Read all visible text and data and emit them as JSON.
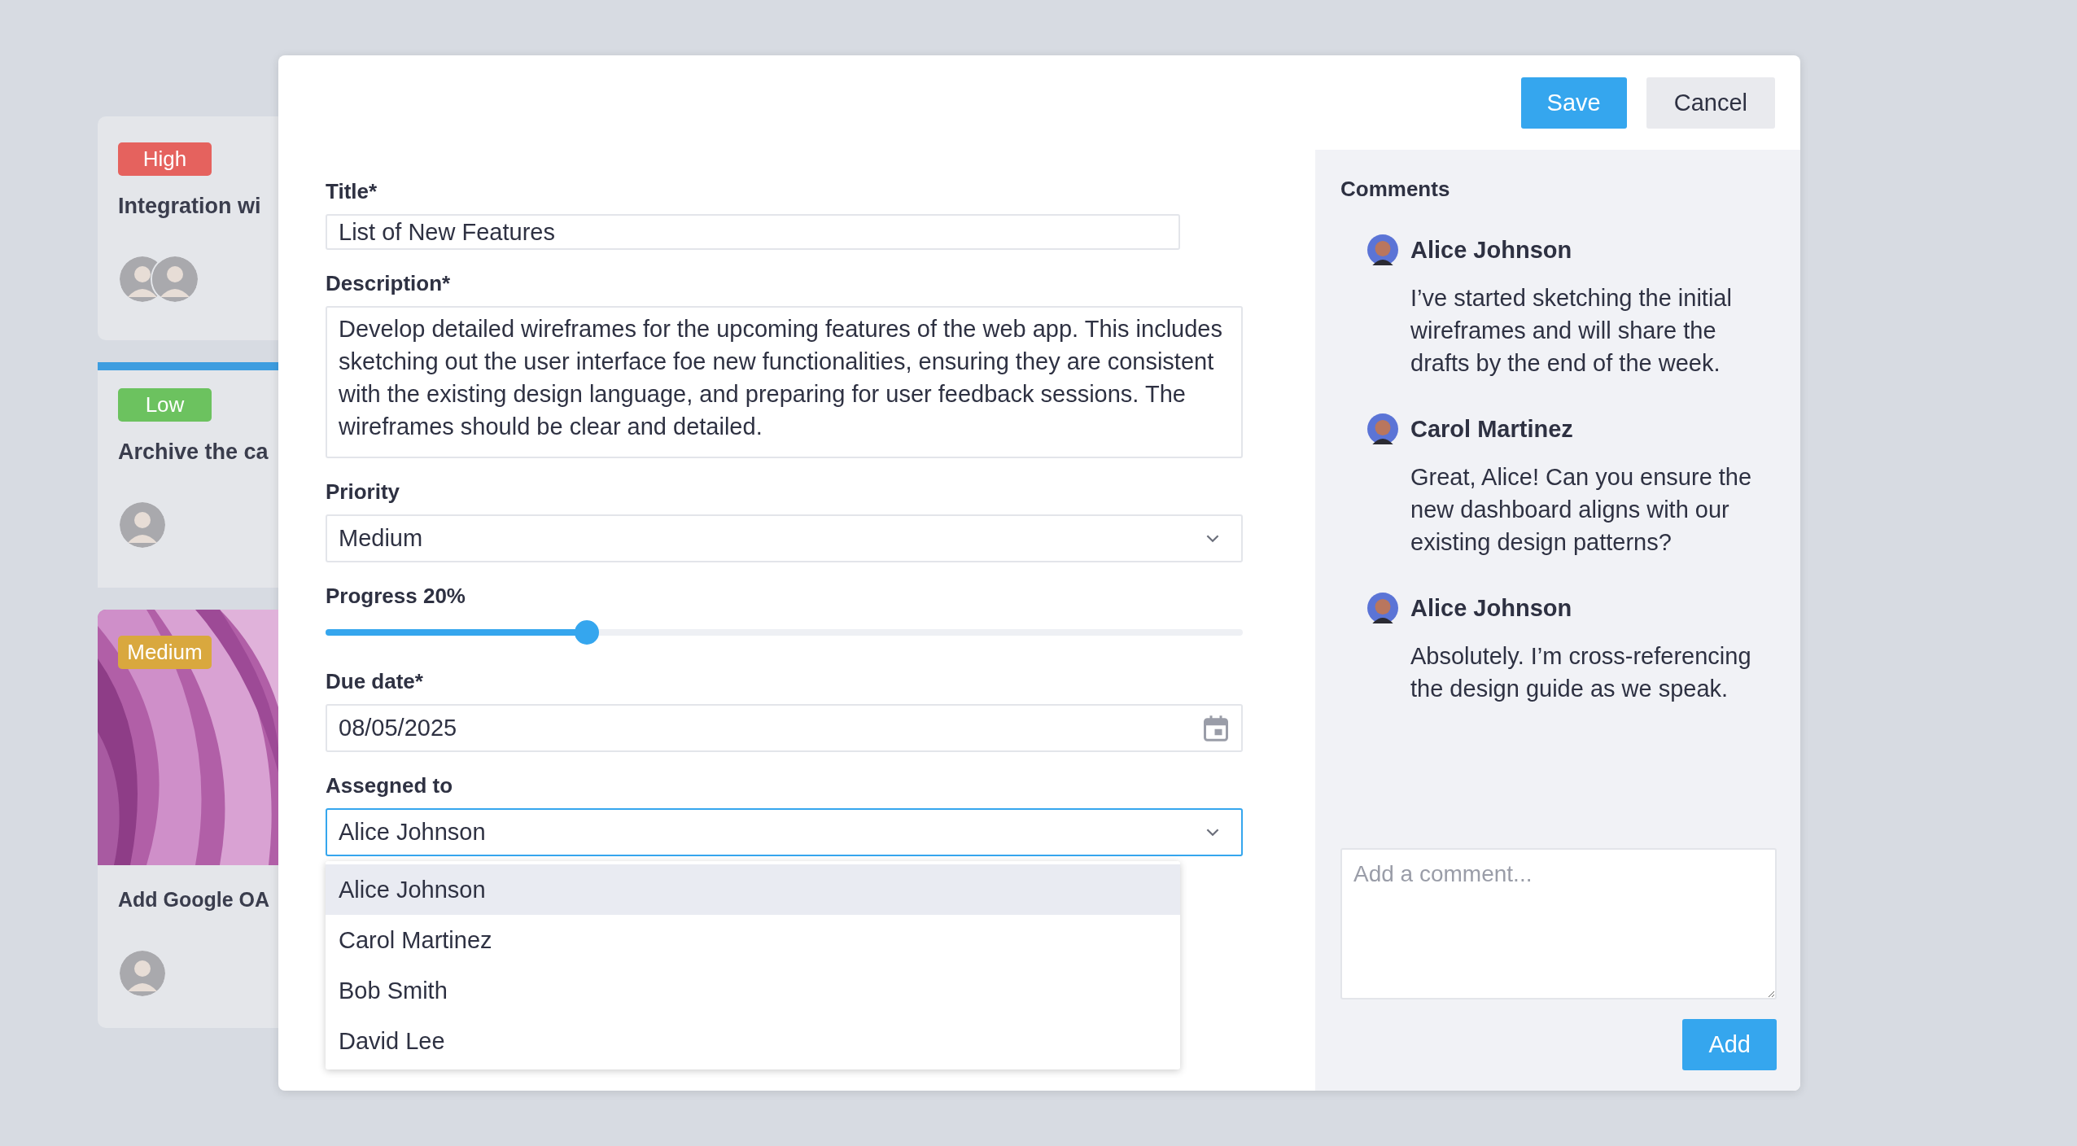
{
  "board_cards": [
    {
      "tag": {
        "label": "High",
        "color": "#e5625e"
      },
      "title": "Integration wi",
      "highlighted": false
    },
    {
      "tag": {
        "label": "Low",
        "color": "#6cc25f"
      },
      "title": "Archive the ca",
      "highlighted": true
    },
    {
      "tag": {
        "label": "Medium",
        "color": "#d9a83e"
      },
      "title": "Add Google OA",
      "highlighted": false
    }
  ],
  "modal": {
    "buttons": [
      {
        "label": "Save",
        "kind": "primary"
      },
      {
        "label": "Cancel",
        "kind": "secondary"
      }
    ],
    "form": {
      "fields": [
        {
          "kind": "text",
          "label": "Title*",
          "value": "List of New Features"
        },
        {
          "kind": "textarea",
          "label": "Description*",
          "value": "Develop detailed wireframes for the upcoming features of the web app. This includes sketching out the user interface foe new functionalities, ensuring they are consistent with the existing design language, and preparing for user feedback sessions. The wireframes should be clear and detailed."
        },
        {
          "kind": "select",
          "label": "Priority",
          "value": "Medium",
          "focused": false
        },
        {
          "kind": "slider",
          "label": "Progress 20%",
          "level": 0.285
        },
        {
          "kind": "date",
          "label": "Due date*",
          "value": "08/05/2025"
        },
        {
          "kind": "select",
          "label": "Assegned to",
          "value": "Alice Johnson",
          "focused": true,
          "options": [
            {
              "label": "Alice Johnson",
              "selected": true
            },
            {
              "label": "Carol Martinez",
              "selected": false
            },
            {
              "label": "Bob Smith",
              "selected": false
            },
            {
              "label": "David Lee",
              "selected": false
            }
          ]
        }
      ]
    },
    "comments": {
      "title": "Comments",
      "items": [
        {
          "author": "Alice Johnson",
          "text": "I’ve started sketching the initial wireframes and will share the drafts by the end of the week."
        },
        {
          "author": "Carol Martinez",
          "text": "Great, Alice! Can you ensure the new dashboard aligns with our existing design patterns?"
        },
        {
          "author": "Alice Johnson",
          "text": "Absolutely. I’m cross-referencing the design guide as we speak."
        }
      ],
      "input": {
        "placeholder": "Add a comment..."
      },
      "button": {
        "label": "Add"
      }
    }
  }
}
